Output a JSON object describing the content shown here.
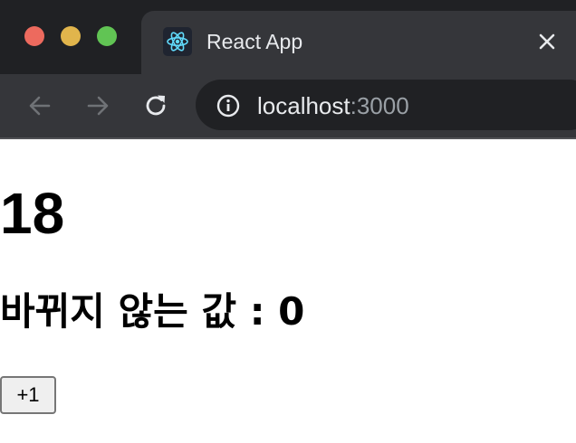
{
  "browser": {
    "tab": {
      "title": "React App",
      "favicon": "react-logo-icon"
    },
    "toolbar": {
      "back_icon": "arrow-left-icon",
      "forward_icon": "arrow-right-icon",
      "reload_icon": "reload-icon"
    },
    "address_bar": {
      "info_icon": "info-icon",
      "host": "localhost",
      "port": ":3000"
    },
    "colors": {
      "tabstrip": "#202124",
      "toolbar": "#35363a",
      "traffic_red": "#ed6a5e",
      "traffic_yellow": "#e1b54c",
      "traffic_green": "#61c454",
      "react_blue": "#61dafb"
    }
  },
  "page": {
    "count": "18",
    "fixed_value_text": "바뀌지 않는 값 : 0",
    "increment_button_label": "+1"
  }
}
